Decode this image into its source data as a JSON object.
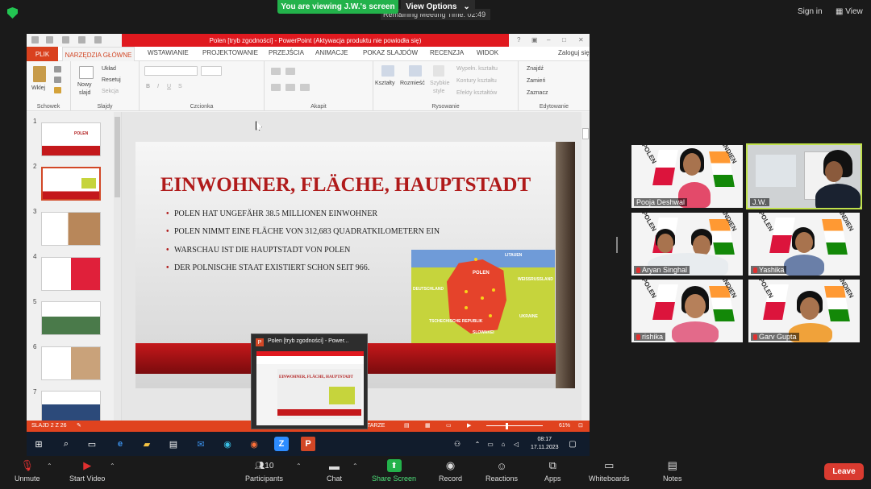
{
  "banner": {
    "viewing": "You are viewing J.W.'s screen",
    "view_options": "View Options",
    "remaining": "Remaining Meeting Time: 02:49"
  },
  "header": {
    "sign_in": "Sign in",
    "view": "View"
  },
  "ppt": {
    "title": "Polen [tryb zgodności] - PowerPoint (Aktywacja produktu nie powiodła się)",
    "tabs": [
      "PLIK",
      "NARZĘDZIA GŁÓWNE",
      "WSTAWIANIE",
      "PROJEKTOWANIE",
      "PRZEJŚCIA",
      "ANIMACJE",
      "POKAZ SLAJDÓW",
      "RECENZJA",
      "WIDOK"
    ],
    "login": "Zaloguj się",
    "ribbon": {
      "wklej": "Wklej",
      "nowy": "Nowy",
      "slajd": "slajd",
      "uklad": "Układ",
      "resetuj": "Resetuj",
      "sekcja": "Sekcja",
      "kszta": "Kształty",
      "rozm": "Rozmieść",
      "szyb": "Szybkie",
      "style": "style",
      "wyp": "Wypełn. kształtu",
      "kont": "Kontury kształtu",
      "efek": "Efekty kształtów",
      "znajdz": "Znajdź",
      "zamien": "Zamień",
      "zaznacz": "Zaznacz",
      "groups": {
        "schowek": "Schowek",
        "slajdy": "Slajdy",
        "czcionka": "Czcionka",
        "akapit": "Akapit",
        "rysowanie": "Rysowanie",
        "edytowanie": "Edytowanie"
      }
    },
    "slide_numbers": [
      "1",
      "2",
      "3",
      "4",
      "5",
      "6",
      "7"
    ],
    "status": {
      "slide": "SLAJD 2 Z 26",
      "notes": "TARZE",
      "zoom": "61%"
    }
  },
  "slide": {
    "title": "EINWOHNER, FLÄCHE, HAUPTSTADT",
    "bullets": [
      "POLEN HAT UNGEFÄHR 38.5 MILLIONEN EINWOHNER",
      "POLEN NIMMT EINE FLÄCHE VON 312,683 QUADRATKILOMETERN EIN",
      "WARSCHAU IST DIE HAUPTSTADT VON POLEN",
      "DER POLNISCHE STAAT EXISTIERT SCHON SEIT 966."
    ],
    "map": {
      "poland": "POLEN",
      "germany": "DEUTSCHLAND",
      "belarus": "WEISSRUSSLAND",
      "ukraine": "UKRAINE",
      "czech": "TSCHECHISCHE REPUBLIK",
      "slovakia": "SLOWAKEI",
      "lithuania": "LITAUEN"
    },
    "thumb1_label": "POLEN"
  },
  "popup": {
    "title": "Polen [tryb zgodności] - Power...",
    "preview_title": "EINWOHNER, FLÄCHE, HAUPTSTADT"
  },
  "taskbar": {
    "time": "08:17",
    "date": "17.11.2023"
  },
  "participants": [
    {
      "name": "Pooja Deshwal"
    },
    {
      "name": "J.W."
    },
    {
      "name": "Aryan Singhal"
    },
    {
      "name": "Yashika"
    },
    {
      "name": "rishika"
    },
    {
      "name": "Garv Gupta"
    }
  ],
  "wall_labels": {
    "polen": "POLEN",
    "indien": "INDIEN"
  },
  "toolbar": {
    "unmute": "Unmute",
    "start_video": "Start Video",
    "participants": "Participants",
    "participants_count": "10",
    "chat": "Chat",
    "share": "Share Screen",
    "record": "Record",
    "reactions": "Reactions",
    "apps": "Apps",
    "whiteboards": "Whiteboards",
    "notes": "Notes",
    "leave": "Leave"
  }
}
